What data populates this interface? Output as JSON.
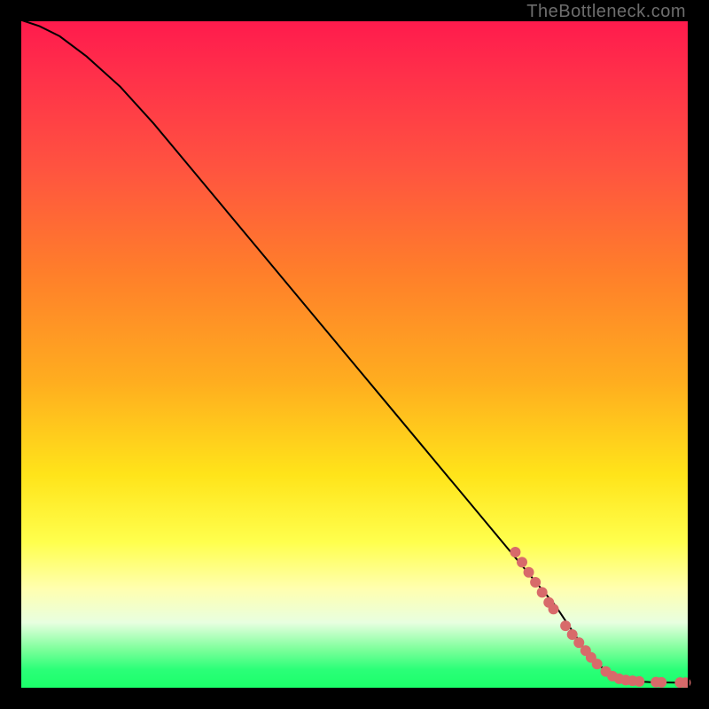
{
  "attribution": "TheBottleneck.com",
  "colors": {
    "gradient_top": "#ff1a4d",
    "gradient_mid": "#ffe41a",
    "gradient_bottom": "#19ff68",
    "curve": "#000000",
    "marker": "#d86a6a",
    "frame_bg": "#000000"
  },
  "chart_data": {
    "type": "line",
    "title": "",
    "xlabel": "",
    "ylabel": "",
    "xlim": [
      0,
      100
    ],
    "ylim": [
      0,
      100
    ],
    "grid": false,
    "legend": false,
    "series": [
      {
        "name": "curve",
        "x": [
          0,
          3,
          6,
          10,
          15,
          20,
          25,
          30,
          35,
          40,
          45,
          50,
          55,
          60,
          65,
          70,
          75,
          80,
          84,
          86,
          88,
          90,
          92,
          94,
          96,
          98,
          100
        ],
        "y": [
          100,
          99,
          97.5,
          94.5,
          90,
          84.5,
          78.5,
          72.5,
          66.5,
          60.5,
          54.5,
          48.5,
          42.5,
          36.5,
          30.5,
          24.5,
          18.5,
          12.5,
          6.5,
          4,
          2.5,
          1.5,
          1.2,
          1.1,
          1.05,
          1.02,
          1
        ]
      }
    ],
    "markers": [
      {
        "x": 74,
        "y": 20.5
      },
      {
        "x": 75,
        "y": 19
      },
      {
        "x": 76,
        "y": 17.5
      },
      {
        "x": 77,
        "y": 16
      },
      {
        "x": 78,
        "y": 14.5
      },
      {
        "x": 79,
        "y": 13
      },
      {
        "x": 79.7,
        "y": 12
      },
      {
        "x": 81.5,
        "y": 9.5
      },
      {
        "x": 82.5,
        "y": 8.2
      },
      {
        "x": 83.5,
        "y": 7
      },
      {
        "x": 84.5,
        "y": 5.8
      },
      {
        "x": 85.3,
        "y": 4.8
      },
      {
        "x": 86.2,
        "y": 3.8
      },
      {
        "x": 87.5,
        "y": 2.7
      },
      {
        "x": 88.5,
        "y": 2
      },
      {
        "x": 89.5,
        "y": 1.6
      },
      {
        "x": 90.5,
        "y": 1.4
      },
      {
        "x": 91.5,
        "y": 1.3
      },
      {
        "x": 92.5,
        "y": 1.2
      },
      {
        "x": 95,
        "y": 1.1
      },
      {
        "x": 95.8,
        "y": 1.08
      },
      {
        "x": 98.6,
        "y": 1.04
      },
      {
        "x": 99.4,
        "y": 1.02
      }
    ],
    "marker_radius_px": 6
  }
}
